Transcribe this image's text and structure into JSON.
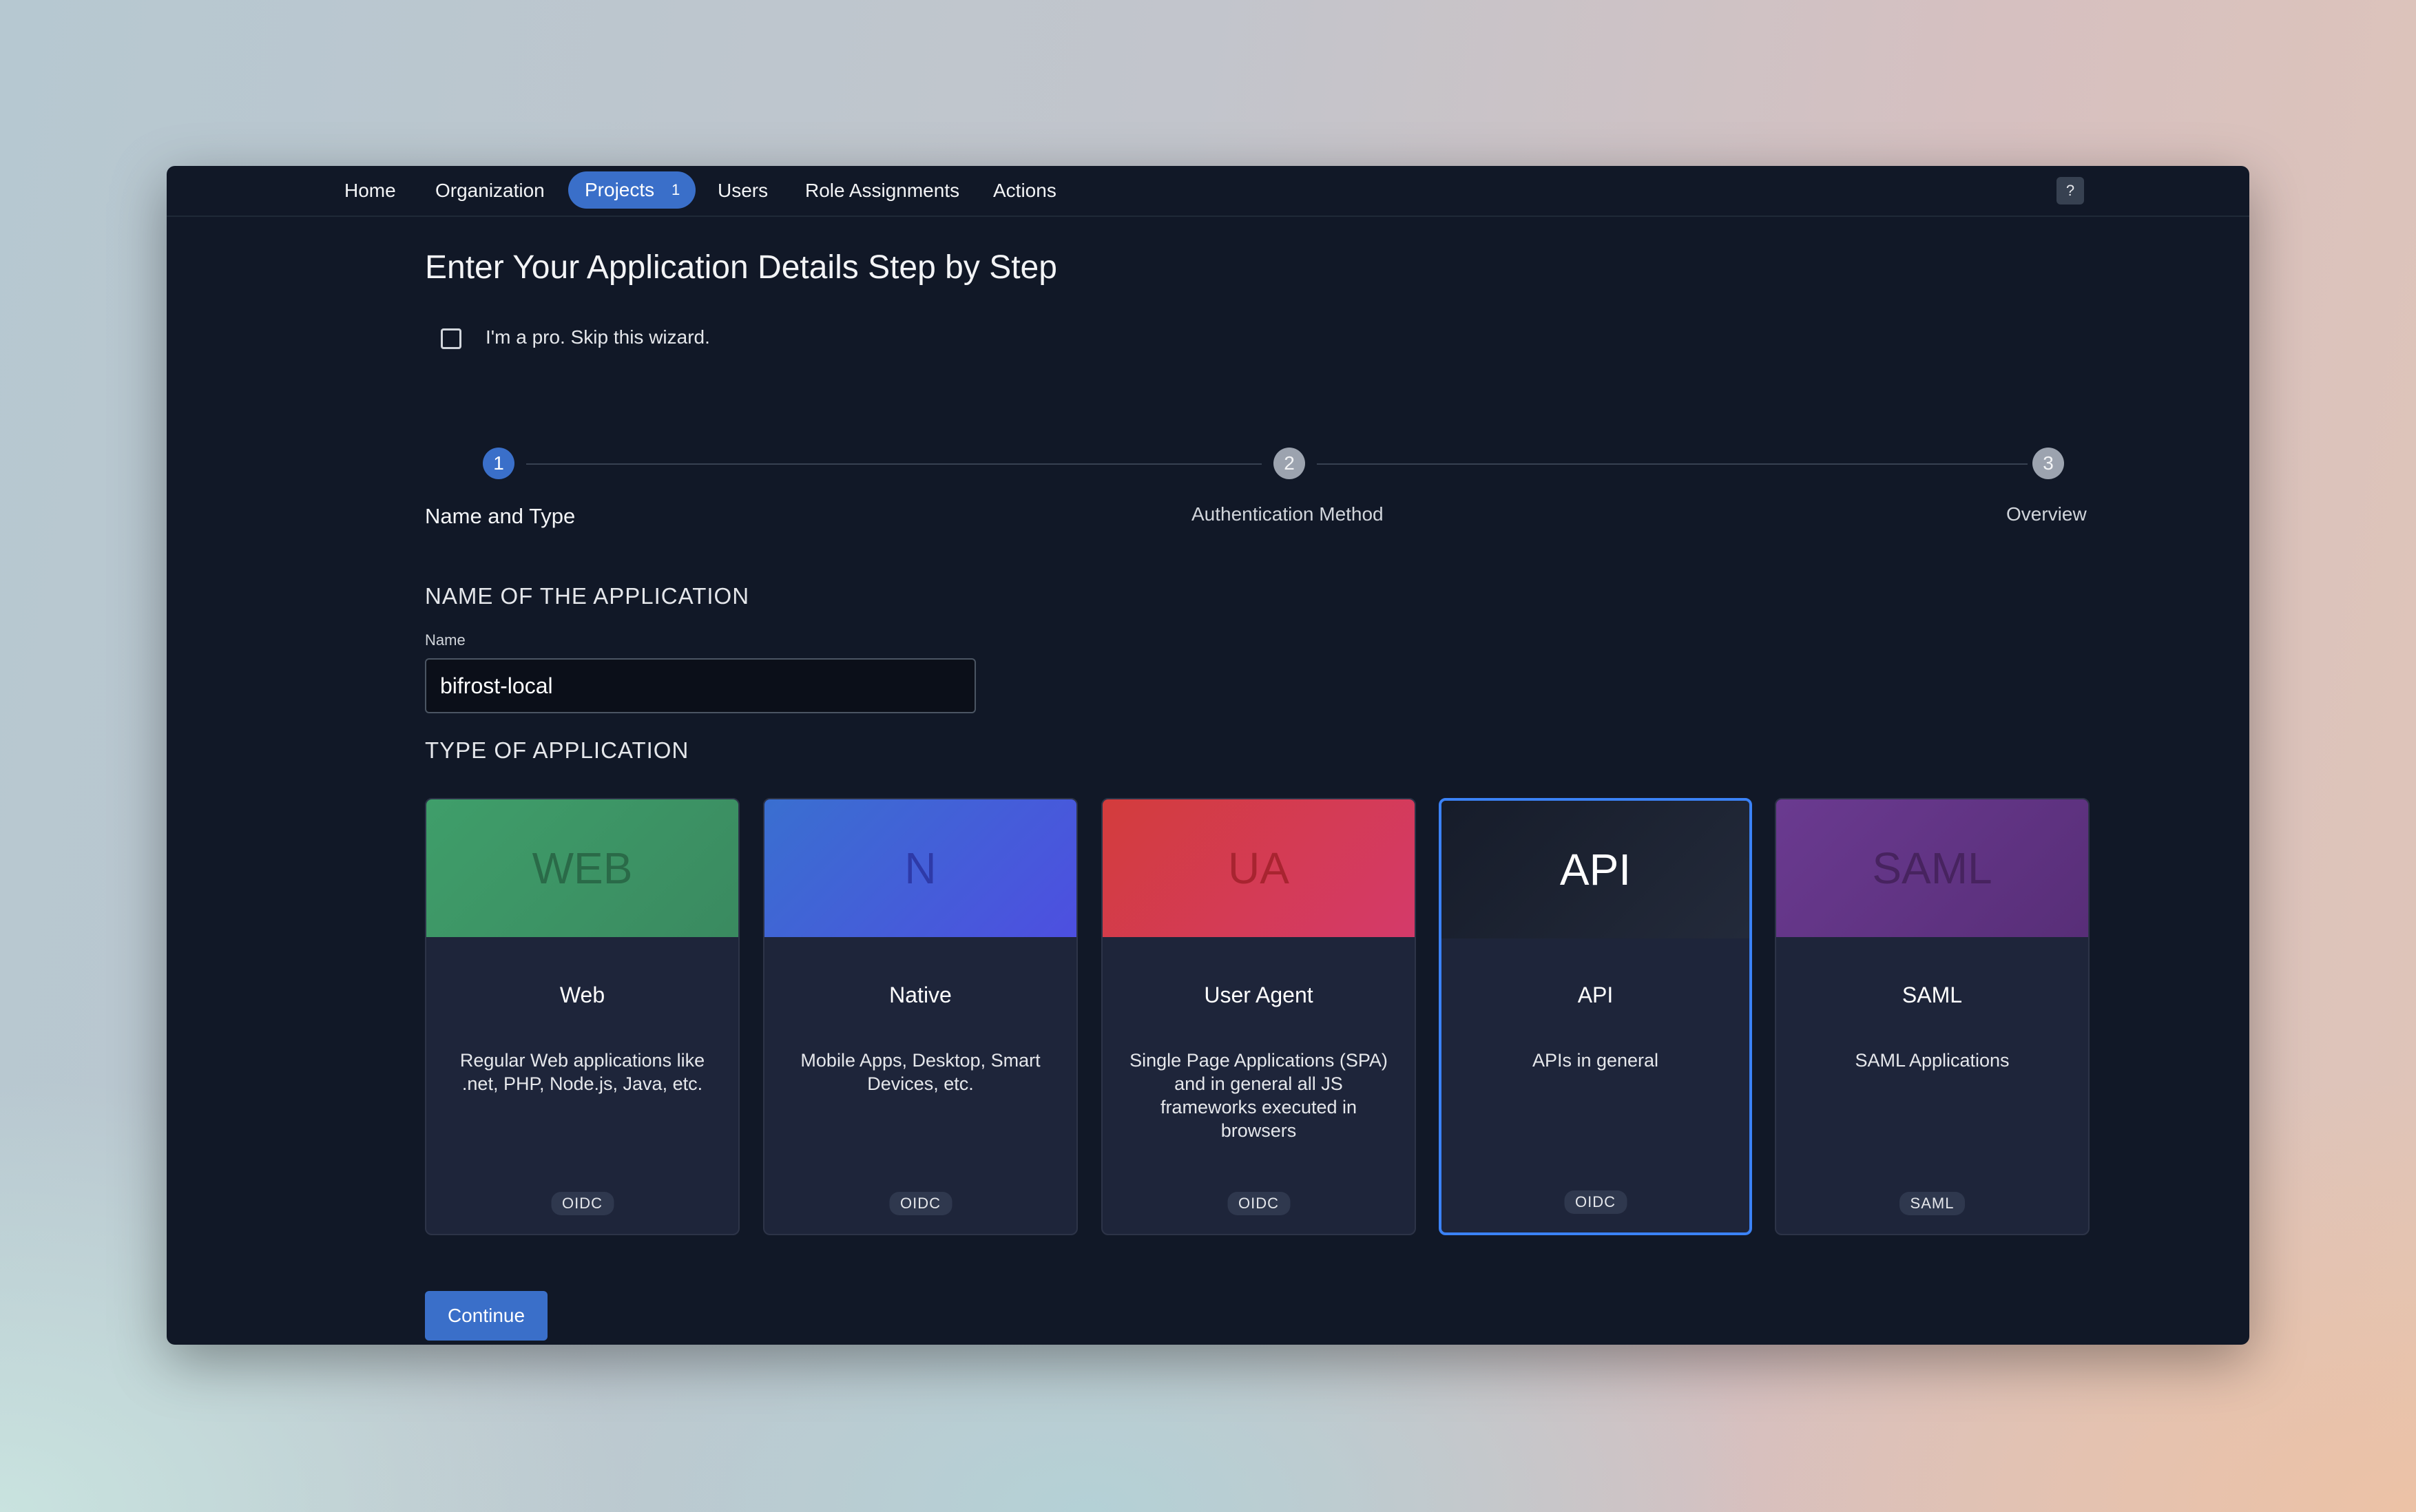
{
  "nav": {
    "items": [
      "Home",
      "Organization",
      "Users",
      "Role Assignments",
      "Actions"
    ],
    "active": {
      "label": "Projects",
      "badge": "1"
    },
    "help_label": "?"
  },
  "page": {
    "title": "Enter Your Application Details Step by Step",
    "skip_wizard": {
      "label": "I'm a pro. Skip this wizard.",
      "checked": false
    }
  },
  "stepper": {
    "steps": [
      {
        "number": "1",
        "label": "Name and Type",
        "state": "active"
      },
      {
        "number": "2",
        "label": "Authentication Method",
        "state": "pending"
      },
      {
        "number": "3",
        "label": "Overview",
        "state": "pending"
      }
    ]
  },
  "name_section": {
    "title": "NAME OF THE APPLICATION",
    "field_label": "Name",
    "value": "bifrost-local"
  },
  "type_section": {
    "title": "TYPE OF APPLICATION",
    "selected": "API",
    "cards": [
      {
        "abbr": "WEB",
        "title": "Web",
        "description": "Regular Web applications like .net, PHP, Node.js, Java, etc.",
        "tag": "OIDC",
        "color": "#3f9e6a"
      },
      {
        "abbr": "N",
        "title": "Native",
        "description": "Mobile Apps, Desktop, Smart Devices, etc.",
        "tag": "OIDC",
        "color": "#4d5ae0"
      },
      {
        "abbr": "UA",
        "title": "User Agent",
        "description": "Single Page Applications (SPA) and in general all JS frameworks executed in browsers",
        "tag": "OIDC",
        "color": "#d8384a"
      },
      {
        "abbr": "API",
        "title": "API",
        "description": "APIs in general",
        "tag": "OIDC",
        "color": "#1e2432"
      },
      {
        "abbr": "SAML",
        "title": "SAML",
        "description": "SAML Applications",
        "tag": "SAML",
        "color": "#6a3a8a"
      }
    ]
  },
  "actions": {
    "continue_label": "Continue"
  },
  "colors": {
    "accent": "#3a6fc9",
    "window_bg": "#111827",
    "card_bg": "#1e253a",
    "selected_border": "#3b82f6"
  }
}
